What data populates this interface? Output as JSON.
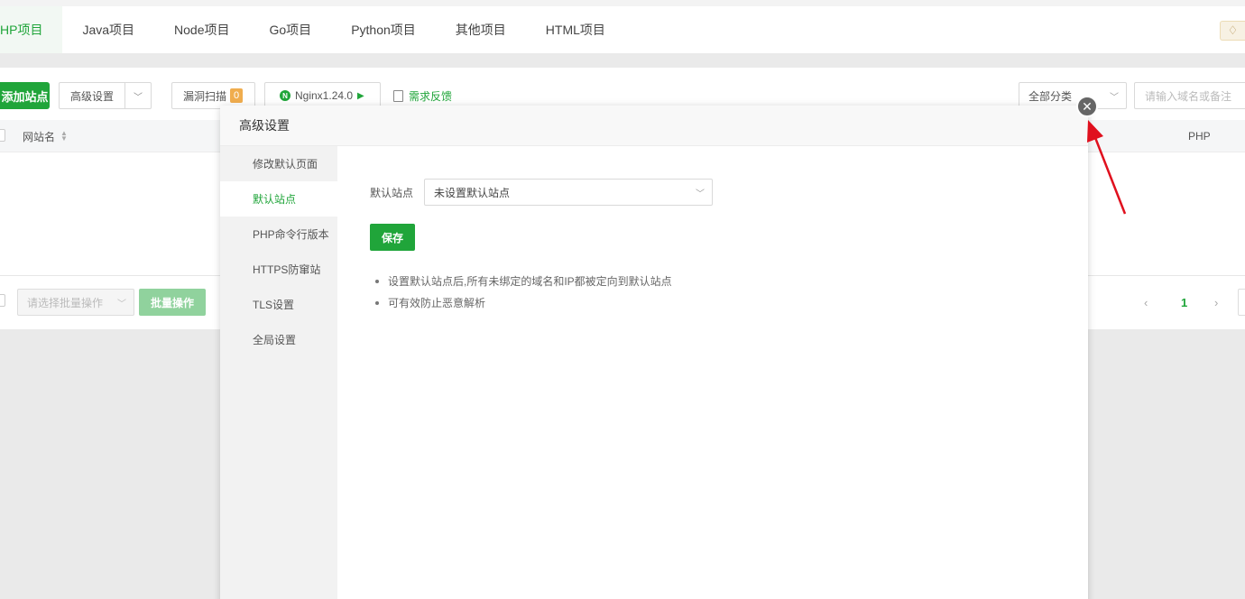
{
  "tabs": [
    {
      "label": "HP项目",
      "active": true
    },
    {
      "label": "Java项目"
    },
    {
      "label": "Node项目"
    },
    {
      "label": "Go项目"
    },
    {
      "label": "Python项目"
    },
    {
      "label": "其他项目"
    },
    {
      "label": "HTML项目"
    }
  ],
  "toolbar": {
    "add_site": "添加站点",
    "advanced": "高级设置",
    "vuln_scan": "漏洞扫描",
    "vuln_count": "0",
    "nginx": "Nginx1.24.0",
    "nginx_icon_letter": "N",
    "feedback": "需求反馈",
    "category": "全部分类",
    "search_placeholder": "请输入域名或备注"
  },
  "table": {
    "col_name": "网站名",
    "col_php": "PHP"
  },
  "footer": {
    "batch_placeholder": "请选择批量操作",
    "batch_button": "批量操作",
    "page_prev": "‹",
    "page_current": "1",
    "page_next": "›"
  },
  "dialog": {
    "title": "高级设置",
    "menu": [
      {
        "label": "修改默认页面"
      },
      {
        "label": "默认站点",
        "active": true
      },
      {
        "label": "PHP命令行版本"
      },
      {
        "label": "HTTPS防窜站"
      },
      {
        "label": "TLS设置"
      },
      {
        "label": "全局设置"
      }
    ],
    "form_label": "默认站点",
    "select_value": "未设置默认站点",
    "save": "保存",
    "tips": [
      "设置默认站点后,所有未绑定的域名和IP都被定向到默认站点",
      "可有效防止恶意解析"
    ],
    "close": "✕"
  },
  "colors": {
    "accent": "#20a53a",
    "annotation_arrow": "#e0101e"
  },
  "icons": {
    "premium": "diamond-icon",
    "close": "close-icon",
    "feedback": "edit-icon"
  }
}
